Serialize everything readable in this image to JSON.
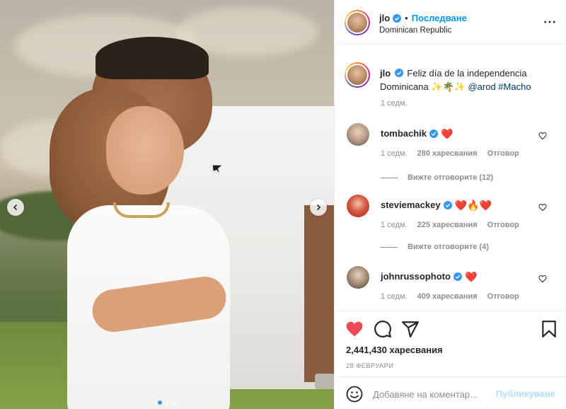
{
  "post": {
    "carousel": {
      "slide_count": 3,
      "active_index": 0
    },
    "author": {
      "username": "jlo",
      "verified": true,
      "follow_label": "Последване",
      "separator": "•",
      "location": "Dominican Republic"
    },
    "caption": {
      "username": "jlo",
      "text": "Feliz día de la independencia Dominicana ✨🌴✨",
      "mention": "@arod",
      "hashtag": "#Macho",
      "time": "1 седм."
    },
    "comments": [
      {
        "username": "tombachik",
        "verified": true,
        "text": "❤️",
        "time": "1 седм.",
        "likes": "280 харесвания",
        "reply_label": "Отговор",
        "view_replies": "Вижте отговорите (12)"
      },
      {
        "username": "steviemackey",
        "verified": true,
        "text": "❤️🔥❤️",
        "time": "1 седм.",
        "likes": "225 харесвания",
        "reply_label": "Отговор",
        "view_replies": "Вижте отговорите (4)"
      },
      {
        "username": "johnrussophoto",
        "verified": true,
        "text": "❤️",
        "time": "1 седм.",
        "likes": "409 харесвания",
        "reply_label": "Отговор"
      }
    ],
    "actions": {
      "liked": true,
      "likes_count": "2,441,430",
      "likes_label": "харесвания",
      "date": "28 ФЕВРУАРИ"
    },
    "add_comment": {
      "placeholder": "Добавяне на коментар...",
      "post_label": "Публикуване"
    }
  },
  "colors": {
    "accent_blue": "#0095f6",
    "verified_blue": "#3897f0",
    "like_red": "#ed4956",
    "secondary_text": "#8e8e8e",
    "link_dark": "#00376b"
  }
}
